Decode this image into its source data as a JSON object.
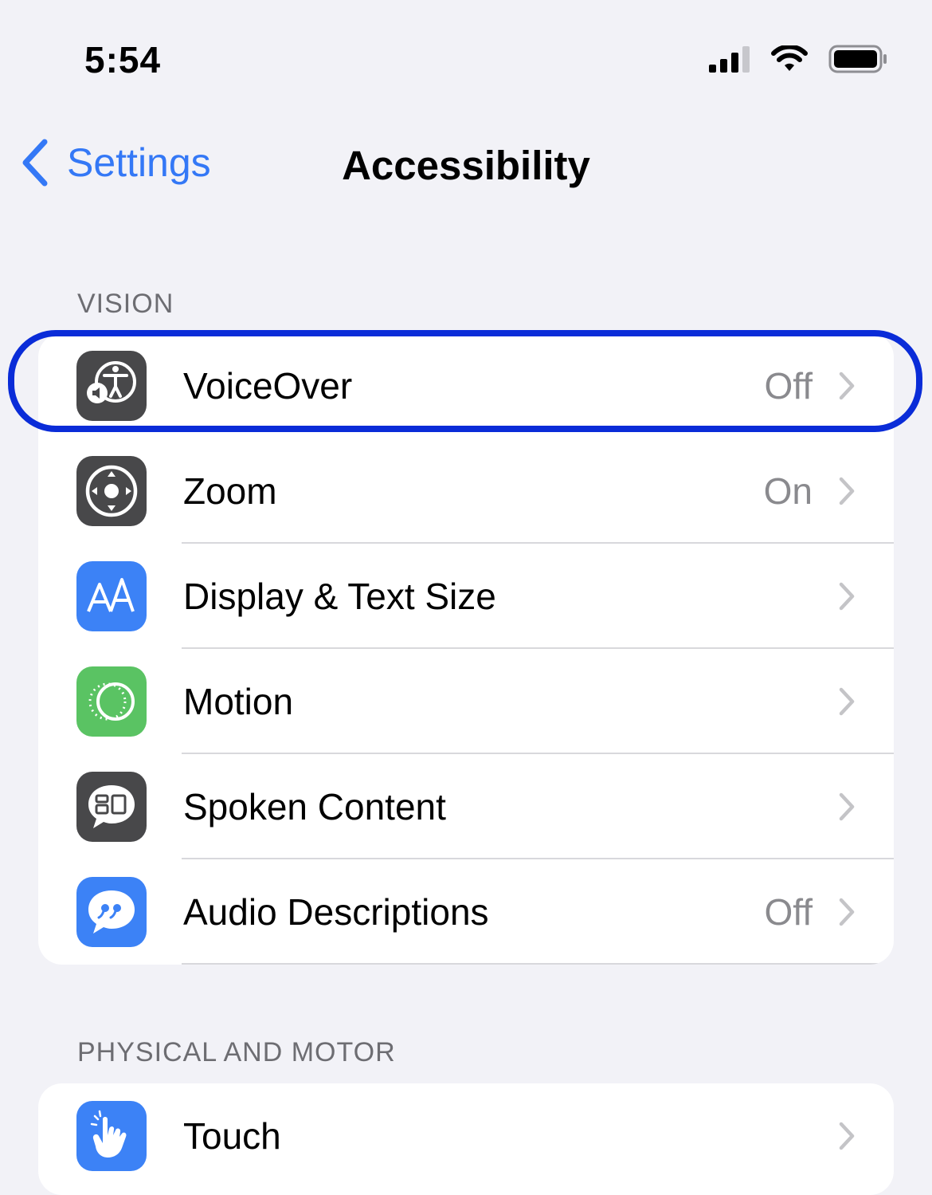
{
  "status_bar": {
    "time": "5:54",
    "signal_icon": "cellular-signal-icon",
    "wifi_icon": "wifi-icon",
    "battery_icon": "battery-icon"
  },
  "nav": {
    "back_label": "Settings",
    "title": "Accessibility",
    "accent_color": "#3478f6"
  },
  "sections": [
    {
      "header": "VISION",
      "items": [
        {
          "label": "VoiceOver",
          "value": "Off",
          "icon": "voiceover-icon",
          "icon_bg": "#48484a"
        },
        {
          "label": "Zoom",
          "value": "On",
          "icon": "zoom-icon",
          "icon_bg": "#48484a"
        },
        {
          "label": "Display & Text Size",
          "value": "",
          "icon": "display-text-size-icon",
          "icon_bg": "#3c82f6"
        },
        {
          "label": "Motion",
          "value": "",
          "icon": "motion-icon",
          "icon_bg": "#5ac363"
        },
        {
          "label": "Spoken Content",
          "value": "",
          "icon": "spoken-content-icon",
          "icon_bg": "#48484a"
        },
        {
          "label": "Audio Descriptions",
          "value": "Off",
          "icon": "audio-descriptions-icon",
          "icon_bg": "#3c82f6"
        }
      ]
    },
    {
      "header": "PHYSICAL AND MOTOR",
      "items": [
        {
          "label": "Touch",
          "value": "",
          "icon": "touch-icon",
          "icon_bg": "#3c82f6"
        }
      ]
    }
  ],
  "highlight_color": "#0a2cd8"
}
